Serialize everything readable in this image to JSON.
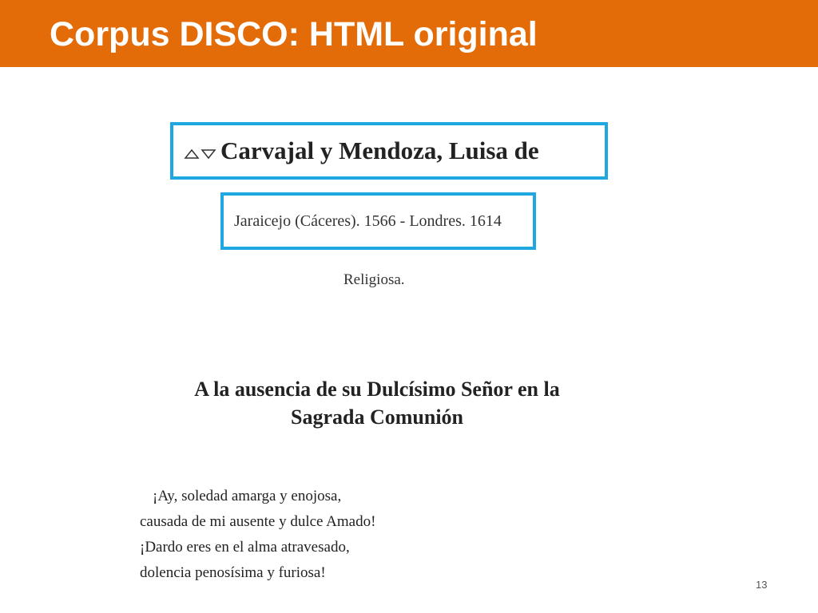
{
  "slide": {
    "title": "Corpus DISCO: HTML original",
    "page_number": "13",
    "accent_color": "#e36c09",
    "box_color": "#1ea7e1"
  },
  "entry": {
    "author": "Carvajal y Mendoza, Luisa de",
    "author_icons": [
      "arrow-up-icon",
      "arrow-down-icon"
    ],
    "dates": "Jaraicejo (Cáceres). 1566 - Londres. 1614",
    "occupation": "Religiosa.",
    "poem_title_lines": [
      "A la ausencia de su Dulcísimo Señor en la",
      "Sagrada Comunión"
    ],
    "poem_lines": [
      "¡Ay, soledad amarga y enojosa,",
      "causada de mi ausente y dulce Amado!",
      "¡Dardo eres en el alma atravesado,",
      "dolencia penosísima y furiosa!"
    ]
  }
}
